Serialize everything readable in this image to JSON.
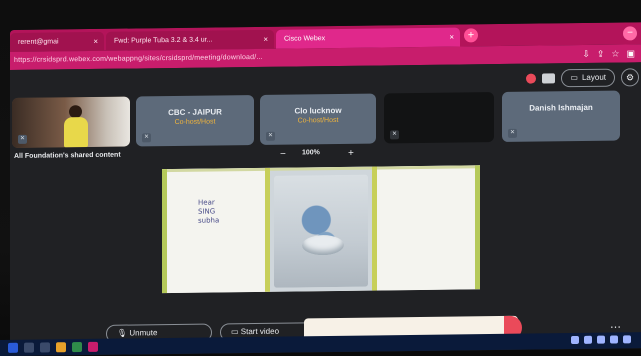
{
  "browser": {
    "tabs": [
      {
        "label": "rerent@gmai"
      },
      {
        "label": "Fwd: Purple Tuba 3.2 & 3.4 ur..."
      },
      {
        "label": "Cisco Webex"
      }
    ],
    "new_tab_glyph": "+",
    "tab_close_glyph": "×",
    "window_control_glyph": "−",
    "url": "https://crsidsprd.webex.com/webappng/sites/crsidsprd/meeting/download/...",
    "url_icons": [
      "download-icon",
      "share-icon",
      "star-icon",
      "sidebar-icon"
    ],
    "accent": "#c81d6c"
  },
  "meeting": {
    "top_controls": {
      "layout_label": "Layout",
      "layout_icon": "layout-icon",
      "settings_icon": "gear-icon"
    },
    "participants": [
      {
        "name": "CBC - JAIPUR",
        "role": "Co-host/Host"
      },
      {
        "name": "Clo lucknow",
        "role": "Co-host/Host"
      },
      {
        "name": "Danish Ishmajan",
        "role": ""
      }
    ],
    "share_label": "All Foundation's shared content",
    "zoom": {
      "minus": "−",
      "value": "100%",
      "plus": "+"
    },
    "shared_content": {
      "note_text": "Hear\nSING\nsubha",
      "left_tag": "",
      "right_tag": ""
    },
    "bottom": {
      "unmute_label": "Unmute",
      "start_video_label": "Start video",
      "toast_text": "",
      "more_icon": "more-icon"
    }
  }
}
